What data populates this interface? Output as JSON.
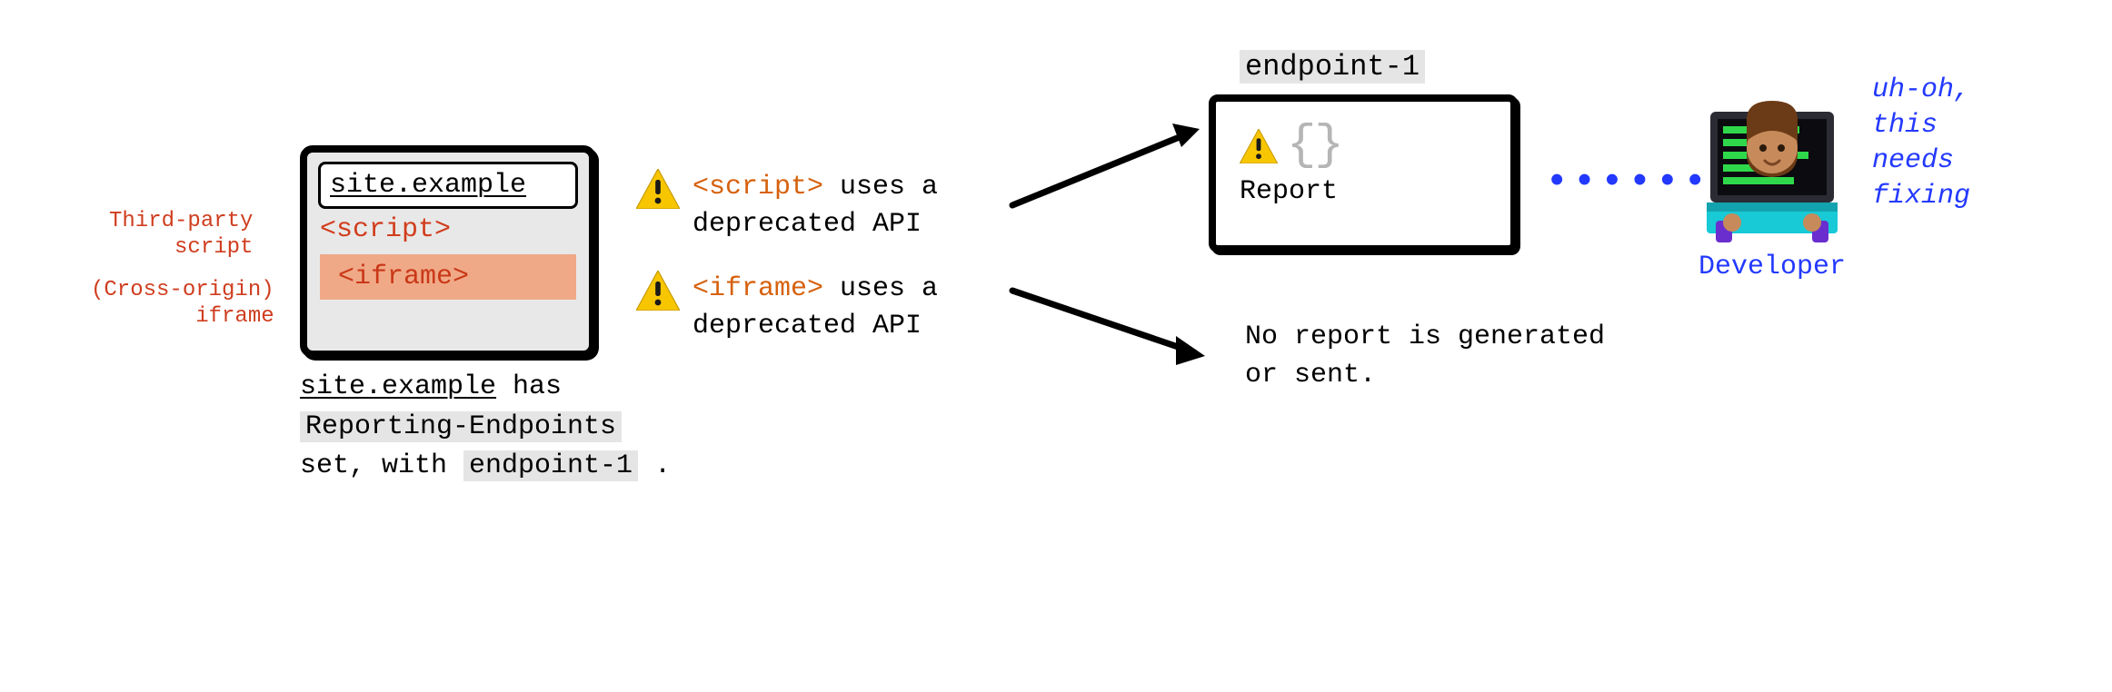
{
  "left_annotations": {
    "script": "Third-party\nscript",
    "iframe": "(Cross-origin)\niframe"
  },
  "browser": {
    "url": "site.example",
    "script_tag": "<script>",
    "iframe_tag": "<iframe>"
  },
  "caption": {
    "site": "site.example",
    "has": " has ",
    "header": "Reporting-Endpoints",
    "set_with": "set, with ",
    "endpoint": "endpoint-1",
    "period": " ."
  },
  "warnings": {
    "script": {
      "code": "<script>",
      "text": " uses a deprecated API"
    },
    "iframe": {
      "code": "<iframe>",
      "text": " uses a deprecated API"
    }
  },
  "endpoint": {
    "label": "endpoint-1",
    "report_label": "Report"
  },
  "no_report_text": "No report is generated or sent.",
  "developer": {
    "label": "Developer",
    "thought": "uh-oh,\nthis\nneeds\nfixing"
  },
  "dots": "••••••"
}
